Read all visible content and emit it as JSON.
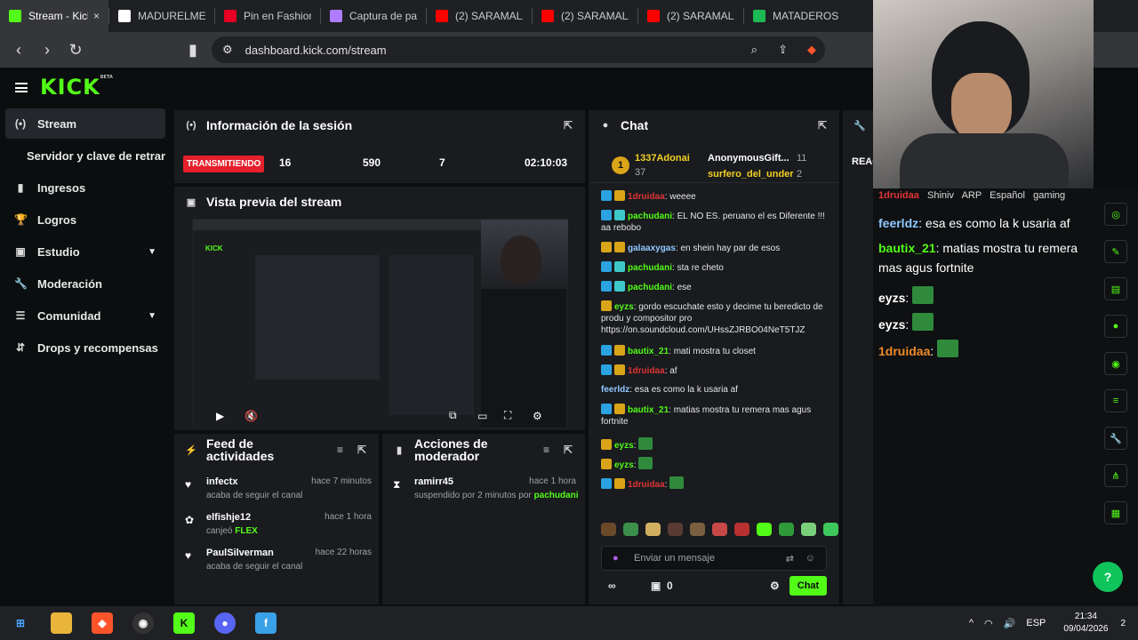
{
  "browser": {
    "tabs": [
      {
        "label": "Stream - Kick",
        "icon": "kick-icon",
        "color": "#53fc18",
        "active": true
      },
      {
        "label": "MADURELME",
        "icon": "x-icon",
        "color": "#ffffff"
      },
      {
        "label": "Pin en Fashion",
        "icon": "pinterest-icon",
        "color": "#e60023"
      },
      {
        "label": "Captura de pa",
        "icon": "pen-icon",
        "color": "#b07cff"
      },
      {
        "label": "(2) SARAMALA",
        "icon": "youtube-icon",
        "color": "#ff0000"
      },
      {
        "label": "(2) SARAMALA",
        "icon": "youtube-icon",
        "color": "#ff0000"
      },
      {
        "label": "(2) SARAMALA",
        "icon": "youtube-icon",
        "color": "#ff0000"
      },
      {
        "label": "MATADEROS",
        "icon": "spotify-icon",
        "color": "#1db954"
      }
    ],
    "url": "dashboard.kick.com/stream"
  },
  "brand": {
    "logo": "KICK",
    "beta": "BETA",
    "accent": "#53fc18"
  },
  "sidebar": {
    "items": [
      {
        "label": "Stream",
        "icon": "stream-icon",
        "glyph": "(•)",
        "active": true
      },
      {
        "label": "Servidor y clave de retransmisión",
        "icon": "",
        "glyph": "",
        "sub": true
      },
      {
        "label": "Ingresos",
        "icon": "chart-icon",
        "glyph": "▮"
      },
      {
        "label": "Logros",
        "icon": "trophy-icon",
        "glyph": "🏆"
      },
      {
        "label": "Estudio",
        "icon": "studio-icon",
        "glyph": "▣",
        "chevron": true
      },
      {
        "label": "Moderación",
        "icon": "wrench-icon",
        "glyph": "🔧"
      },
      {
        "label": "Comunidad",
        "icon": "community-icon",
        "glyph": "☰",
        "chevron": true
      },
      {
        "label": "Drops y recompensas",
        "icon": "drops-icon",
        "glyph": "⇵"
      }
    ]
  },
  "session": {
    "title": "Información de la sesión",
    "live_badge": "TRANSMITIENDO",
    "stats": [
      "16",
      "590",
      "7",
      "02:10:03"
    ]
  },
  "preview": {
    "title": "Vista previa del stream"
  },
  "feed": {
    "title": "Feed de actividades",
    "items": [
      {
        "name": "infectx",
        "desc": "acaba de seguir el canal",
        "time": "hace 7 minutos",
        "icon": "heart-icon"
      },
      {
        "name": "elfishje12",
        "desc_pre": "canjeó",
        "desc_highlight": "FLEX",
        "time": "hace 1 hora",
        "icon": "reward-icon"
      },
      {
        "name": "PaulSilverman",
        "desc": "acaba de seguir el canal",
        "time": "hace 22 horas",
        "icon": "heart-icon"
      }
    ]
  },
  "mod": {
    "title": "Acciones de moderador",
    "items": [
      {
        "name": "ramirr45",
        "desc_pre": "suspendido por 2 minutos por",
        "desc_highlight": "pachudani",
        "time": "hace 1 hora"
      }
    ]
  },
  "chat": {
    "title": "Chat",
    "leaderboard": [
      {
        "name": "1337Adonai",
        "count": "37"
      },
      {
        "name": "AnonymousGift...",
        "count": "11"
      },
      {
        "name": "surfero_del_under",
        "count": "2"
      }
    ],
    "messages": [
      {
        "user": "1druidaa",
        "ucolor": "c-red",
        "badges": [
          "b-blue",
          "b-gold"
        ],
        "text": "weeee"
      },
      {
        "user": "pachudani",
        "ucolor": "c-green",
        "badges": [
          "b-blue",
          "b-teal"
        ],
        "text": "EL NO ES. peruano el es Diferente !!! aa rebobo"
      },
      {
        "user": "galaaxygas",
        "ucolor": "c-blue",
        "badges": [
          "b-gold",
          "b-gold"
        ],
        "text": "en shein hay par de esos"
      },
      {
        "user": "pachudani",
        "ucolor": "c-green",
        "badges": [
          "b-blue",
          "b-teal"
        ],
        "text": "sta re cheto"
      },
      {
        "user": "pachudani",
        "ucolor": "c-green",
        "badges": [
          "b-blue",
          "b-teal"
        ],
        "text": "ese"
      },
      {
        "user": "eyzs",
        "ucolor": "c-green",
        "badges": [
          "b-gold"
        ],
        "text": "gordo escuchate esto y decime tu beredicto de produ y compositor pro https://on.soundcloud.com/UHssZJRBO04NeT5TJZ"
      },
      {
        "user": "bautix_21",
        "ucolor": "c-green",
        "badges": [
          "b-blue",
          "b-gold"
        ],
        "text": "mati mostra tu closet"
      },
      {
        "user": "1druidaa",
        "ucolor": "c-red",
        "badges": [
          "b-blue",
          "b-gold"
        ],
        "text": "af"
      },
      {
        "user": "feerldz",
        "ucolor": "c-blue",
        "badges": [],
        "text": "esa es como la k usaria af"
      },
      {
        "user": "bautix_21",
        "ucolor": "c-green",
        "badges": [
          "b-blue",
          "b-gold"
        ],
        "text": "matias mostra tu remera mas agus fortnite"
      },
      {
        "user": "eyzs",
        "ucolor": "c-green",
        "badges": [
          "b-gold"
        ],
        "text": ""
      },
      {
        "user": "eyzs",
        "ucolor": "c-green",
        "badges": [
          "b-gold"
        ],
        "text": ""
      },
      {
        "user": "1druidaa",
        "ucolor": "c-red",
        "badges": [
          "b-blue",
          "b-gold"
        ],
        "text": ""
      }
    ],
    "input_placeholder": "Enviar un mensaje",
    "viewers": "0",
    "send_label": "Chat"
  },
  "overlay": {
    "top_tags": [
      "Shiniv",
      "ARP",
      "Español",
      "gaming"
    ],
    "top_user": "1druidaa",
    "messages": [
      {
        "user": "feerldz",
        "ucolor": "c-blue",
        "text": "esa es como la k usaria af"
      },
      {
        "user": "bautix_21",
        "ucolor": "c-green",
        "text": "matias mostra tu remera mas agus fortnite"
      },
      {
        "user": "eyzs",
        "ucolor": "c-white",
        "text": ""
      },
      {
        "user": "eyzs",
        "ucolor": "c-white",
        "text": ""
      },
      {
        "user": "1druidaa",
        "ucolor": "c-orange",
        "text": ""
      }
    ],
    "side_label": "REAC"
  },
  "taskbar": {
    "apps": [
      "windows-icon",
      "folder-icon",
      "brave-icon",
      "obs-icon",
      "kick-icon",
      "discord-icon",
      "facebook-icon"
    ],
    "lang": "ESP",
    "time": "21:34",
    "date": "09/04/2026",
    "notif": "2"
  }
}
